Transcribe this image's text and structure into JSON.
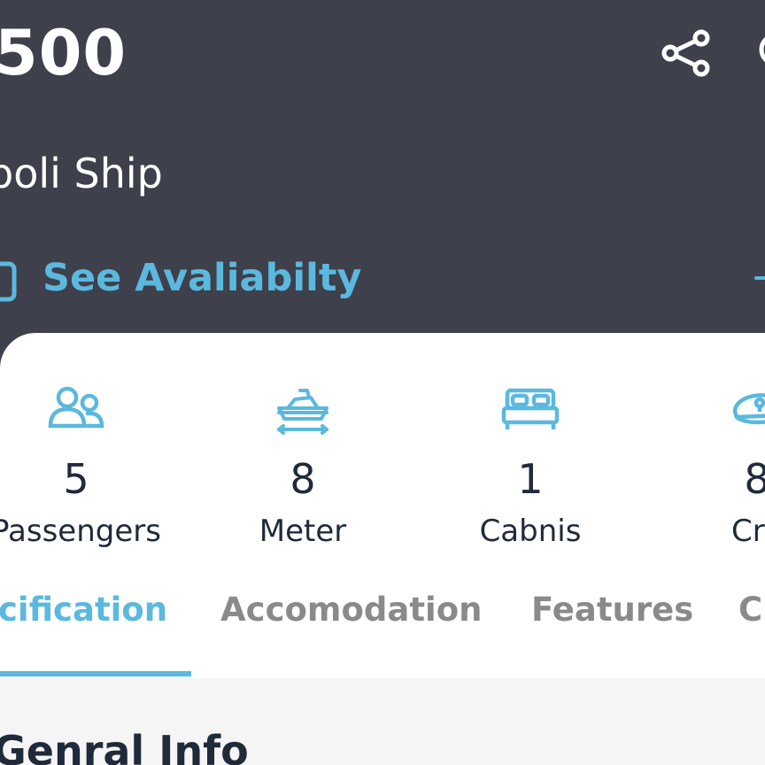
{
  "header": {
    "price": "500",
    "ship_name": "poli Ship",
    "availability_label": "See Avaliabilty",
    "share_icon": "share-icon",
    "calendar_icon": "calendar-icon"
  },
  "specs": [
    {
      "icon": "passengers-icon",
      "value": "5",
      "label": "Passengers"
    },
    {
      "icon": "boat-length-icon",
      "value": "8",
      "label": "Meter"
    },
    {
      "icon": "bed-icon",
      "value": "1",
      "label": "Cabnis"
    },
    {
      "icon": "captain-hat-icon",
      "value": "8",
      "label": "Cre"
    }
  ],
  "tabs": [
    {
      "label": "cification",
      "active": true
    },
    {
      "label": "Accomodation",
      "active": false
    },
    {
      "label": "Features",
      "active": false
    },
    {
      "label": "C",
      "active": false
    }
  ],
  "content": {
    "section_title": "Genral Info"
  },
  "colors": {
    "header_bg": "#3e404b",
    "accent": "#5bb8de",
    "text_dark": "#1f2a3a",
    "tab_inactive": "#8a8a8a",
    "content_bg": "#f5f5f6"
  }
}
